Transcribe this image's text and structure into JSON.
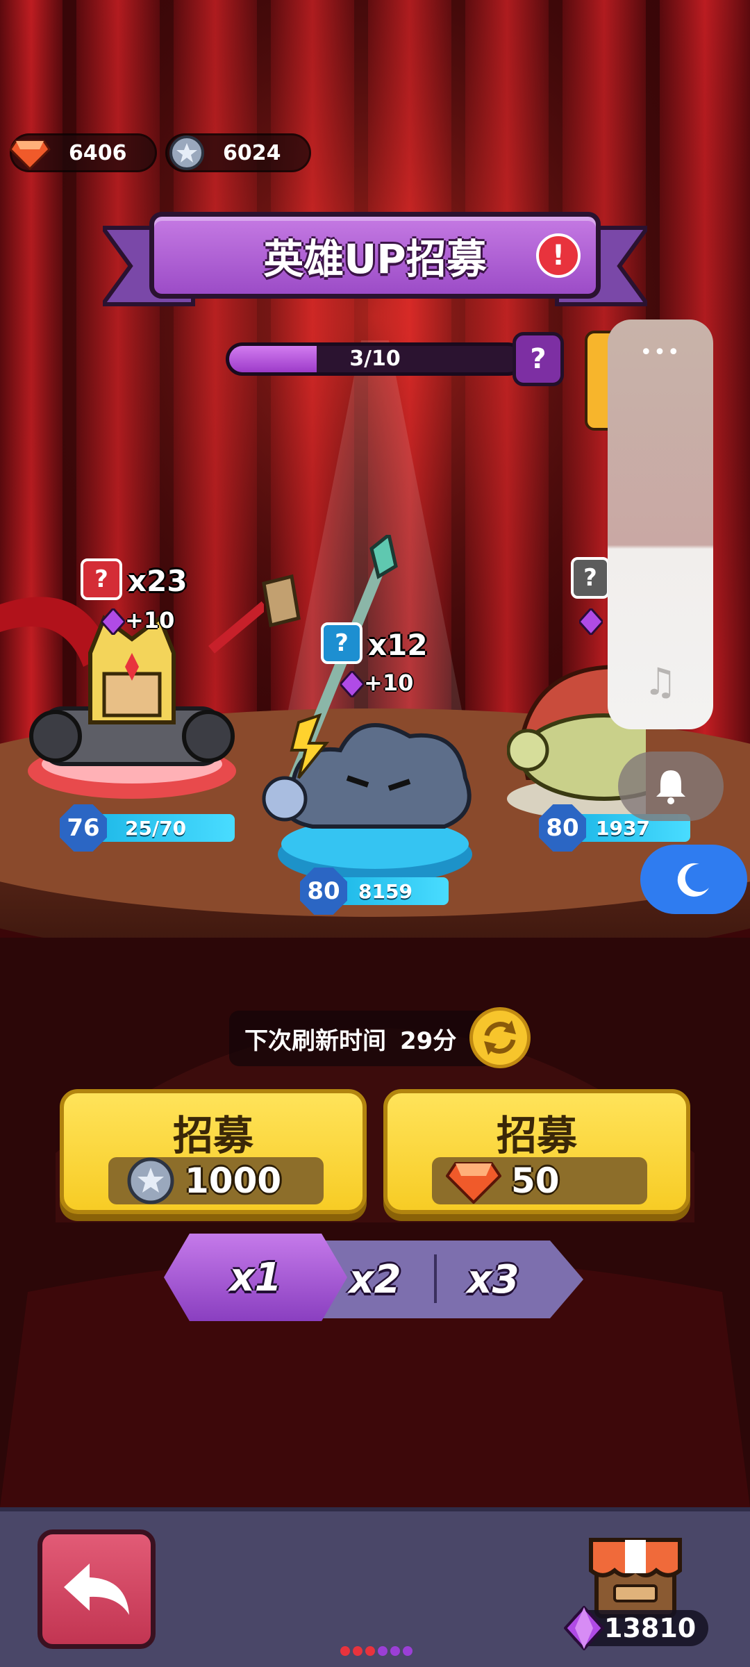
{
  "currencies": [
    {
      "name": "gems",
      "value": "6406"
    },
    {
      "name": "coins",
      "value": "6024"
    }
  ],
  "title": "英雄UP招募",
  "progress": {
    "label": "3/10",
    "fraction": 0.3
  },
  "heroes": [
    {
      "name": "red-knight",
      "count": "x23",
      "bonus": "+10",
      "level": "76",
      "exp": "25/70"
    },
    {
      "name": "storm-cloud",
      "count": "x12",
      "bonus": "+10",
      "level": "80",
      "exp": "8159"
    },
    {
      "name": "mushroom",
      "count": "",
      "bonus": "",
      "level": "80",
      "exp": "1937"
    }
  ],
  "refresh": {
    "label": "下次刷新时间",
    "time": "29分"
  },
  "recruit": [
    {
      "label": "招募",
      "currency": "coin",
      "cost": "1000"
    },
    {
      "label": "招募",
      "currency": "gem",
      "cost": "50"
    }
  ],
  "multipliers": {
    "options": [
      "x1",
      "x2",
      "x3"
    ],
    "selected": "x1"
  },
  "bottom": {
    "gem_balance": "13810"
  },
  "page_dot_colors": [
    "#e8333d",
    "#e8333d",
    "#e8333d",
    "#9b3fd6",
    "#9b3fd6",
    "#9b3fd6"
  ],
  "icons": {
    "back": "back-arrow-icon",
    "shop": "shop-icon",
    "help": "question-icon",
    "warning": "exclamation-icon",
    "refresh": "refresh-icon"
  }
}
